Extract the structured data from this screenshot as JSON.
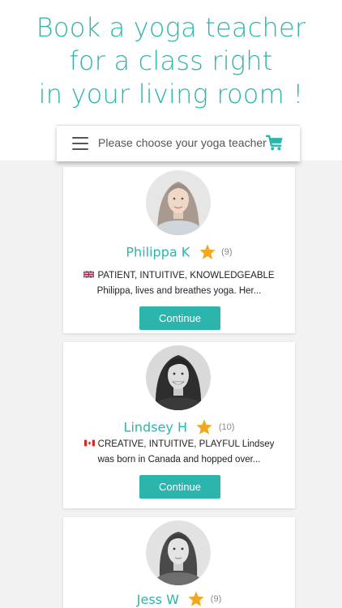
{
  "headline": {
    "line1": "Book a yoga teacher",
    "line2": "for a class right",
    "line3": "in your living room !"
  },
  "toolbar": {
    "prompt": "Please choose your yoga teacher",
    "menu_icon": "hamburger-menu-icon",
    "cart_icon": "shopping-cart-icon"
  },
  "colors": {
    "accent": "#2bb5ad",
    "star": "#f2a81d"
  },
  "teachers": [
    {
      "name": "Philippa K",
      "rating_count": "(9)",
      "flag": "uk-flag-icon",
      "description": "PATIENT, INTUITIVE, KNOWLEDGEABLE Philippa, lives and breathes yoga. Her...",
      "button": "Continue"
    },
    {
      "name": "Lindsey H",
      "rating_count": "(10)",
      "flag": "canada-flag-icon",
      "description": "CREATIVE, INTUITIVE, PLAYFUL Lindsey was born in Canada and hopped over...",
      "button": "Continue"
    },
    {
      "name": "Jess W",
      "rating_count": "(9)"
    }
  ]
}
